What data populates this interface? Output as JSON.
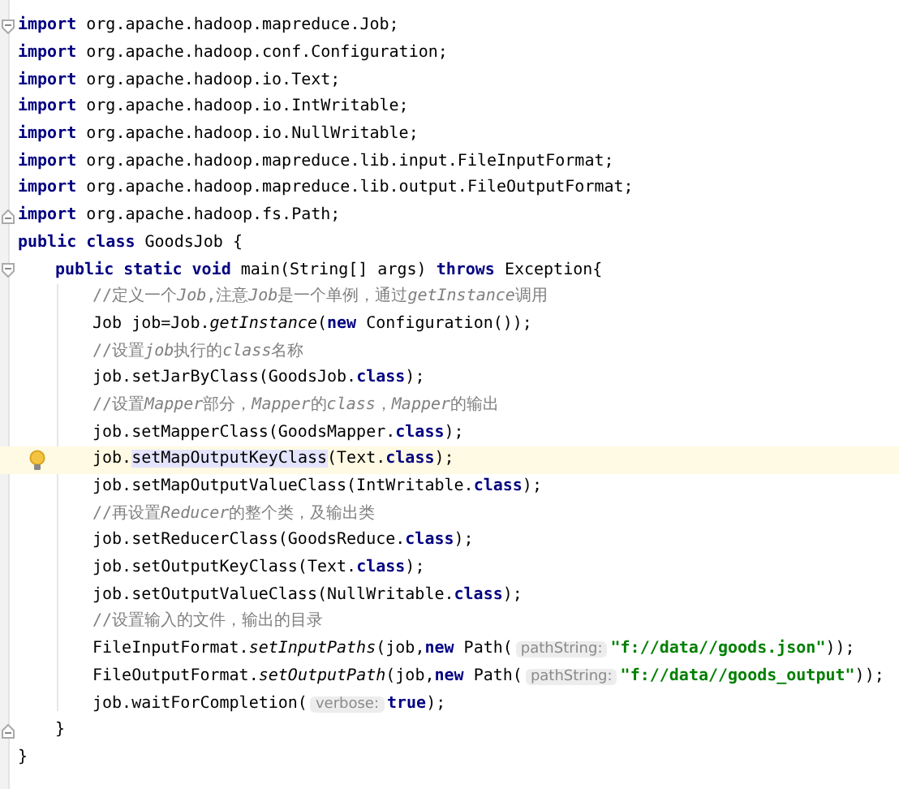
{
  "lines": [
    {
      "selected": false,
      "bulb": false,
      "fold_open": true,
      "fold_close": false,
      "tokens": [
        {
          "kind": "keyword",
          "text": "import"
        },
        {
          "kind": "plain",
          "text": " org.apache.hadoop.mapreduce.Job;"
        }
      ]
    },
    {
      "selected": false,
      "bulb": false,
      "fold_open": false,
      "fold_close": false,
      "tokens": [
        {
          "kind": "keyword",
          "text": "import"
        },
        {
          "kind": "plain",
          "text": " org.apache.hadoop.conf.Configuration;"
        }
      ]
    },
    {
      "selected": false,
      "bulb": false,
      "fold_open": false,
      "fold_close": false,
      "tokens": [
        {
          "kind": "keyword",
          "text": "import"
        },
        {
          "kind": "plain",
          "text": " org.apache.hadoop.io.Text;"
        }
      ]
    },
    {
      "selected": false,
      "bulb": false,
      "fold_open": false,
      "fold_close": false,
      "tokens": [
        {
          "kind": "keyword",
          "text": "import"
        },
        {
          "kind": "plain",
          "text": " org.apache.hadoop.io.IntWritable;"
        }
      ]
    },
    {
      "selected": false,
      "bulb": false,
      "fold_open": false,
      "fold_close": false,
      "tokens": [
        {
          "kind": "keyword",
          "text": "import"
        },
        {
          "kind": "plain",
          "text": " org.apache.hadoop.io.NullWritable;"
        }
      ]
    },
    {
      "selected": false,
      "bulb": false,
      "fold_open": false,
      "fold_close": false,
      "tokens": [
        {
          "kind": "keyword",
          "text": "import"
        },
        {
          "kind": "plain",
          "text": " org.apache.hadoop.mapreduce.lib.input.FileInputFormat;"
        }
      ]
    },
    {
      "selected": false,
      "bulb": false,
      "fold_open": false,
      "fold_close": false,
      "tokens": [
        {
          "kind": "keyword",
          "text": "import"
        },
        {
          "kind": "plain",
          "text": " org.apache.hadoop.mapreduce.lib.output.FileOutputFormat;"
        }
      ]
    },
    {
      "selected": false,
      "bulb": false,
      "fold_open": false,
      "fold_close": true,
      "tokens": [
        {
          "kind": "keyword",
          "text": "import"
        },
        {
          "kind": "plain",
          "text": " org.apache.hadoop.fs.Path;"
        }
      ]
    },
    {
      "selected": false,
      "bulb": false,
      "fold_open": false,
      "fold_close": false,
      "tokens": [
        {
          "kind": "keyword",
          "text": "public class"
        },
        {
          "kind": "plain",
          "text": " GoodsJob {"
        }
      ],
      "children": [
        {
          "selected": false,
          "bulb": false,
          "fold_open": true,
          "fold_close": false,
          "tokens": [
            {
              "kind": "keyword",
              "text": "public static void"
            },
            {
              "kind": "plain",
              "text": " main(String[] args) "
            },
            {
              "kind": "keyword",
              "text": "throws"
            },
            {
              "kind": "plain",
              "text": " Exception{"
            }
          ],
          "children": [
            {
              "selected": false,
              "bulb": false,
              "fold_open": false,
              "fold_close": false,
              "tokens": [
                {
                  "kind": "comment",
                  "text": "//定义一个"
                },
                {
                  "kind": "comment_italic",
                  "text": "Job"
                },
                {
                  "kind": "comment",
                  "text": ",注意"
                },
                {
                  "kind": "comment_italic",
                  "text": "Job"
                },
                {
                  "kind": "comment",
                  "text": "是一个单例，通过"
                },
                {
                  "kind": "comment_italic",
                  "text": "getInstance"
                },
                {
                  "kind": "comment",
                  "text": "调用"
                }
              ]
            },
            {
              "selected": false,
              "bulb": false,
              "fold_open": false,
              "fold_close": false,
              "tokens": [
                {
                  "kind": "plain",
                  "text": "Job job=Job."
                },
                {
                  "kind": "italic",
                  "text": "getInstance"
                },
                {
                  "kind": "plain",
                  "text": "("
                },
                {
                  "kind": "keyword",
                  "text": "new"
                },
                {
                  "kind": "plain",
                  "text": " Configuration());"
                }
              ]
            },
            {
              "selected": false,
              "bulb": false,
              "fold_open": false,
              "fold_close": false,
              "tokens": [
                {
                  "kind": "comment",
                  "text": "//设置"
                },
                {
                  "kind": "comment_italic",
                  "text": "job"
                },
                {
                  "kind": "comment",
                  "text": "执行的"
                },
                {
                  "kind": "comment_italic",
                  "text": "class"
                },
                {
                  "kind": "comment",
                  "text": "名称"
                }
              ]
            },
            {
              "selected": false,
              "bulb": false,
              "fold_open": false,
              "fold_close": false,
              "tokens": [
                {
                  "kind": "plain",
                  "text": "job.setJarByClass(GoodsJob."
                },
                {
                  "kind": "keyword",
                  "text": "class"
                },
                {
                  "kind": "plain",
                  "text": ");"
                }
              ]
            },
            {
              "selected": false,
              "bulb": false,
              "fold_open": false,
              "fold_close": false,
              "tokens": [
                {
                  "kind": "comment",
                  "text": "//设置"
                },
                {
                  "kind": "comment_italic",
                  "text": "Mapper"
                },
                {
                  "kind": "comment",
                  "text": "部分，"
                },
                {
                  "kind": "comment_italic",
                  "text": "Mapper"
                },
                {
                  "kind": "comment",
                  "text": "的"
                },
                {
                  "kind": "comment_italic",
                  "text": "class"
                },
                {
                  "kind": "comment",
                  "text": "，"
                },
                {
                  "kind": "comment_italic",
                  "text": "Mapper"
                },
                {
                  "kind": "comment",
                  "text": "的输出"
                }
              ]
            },
            {
              "selected": false,
              "bulb": false,
              "fold_open": false,
              "fold_close": false,
              "tokens": [
                {
                  "kind": "plain",
                  "text": "job.setMapperClass(GoodsMapper."
                },
                {
                  "kind": "keyword",
                  "text": "class"
                },
                {
                  "kind": "plain",
                  "text": ");"
                }
              ]
            },
            {
              "selected": true,
              "bulb": true,
              "fold_open": false,
              "fold_close": false,
              "tokens": [
                {
                  "kind": "plain",
                  "text": "job."
                },
                {
                  "kind": "match",
                  "text": "setMapOutputKeyClass"
                },
                {
                  "kind": "plain",
                  "text": "(Text."
                },
                {
                  "kind": "keyword",
                  "text": "class"
                },
                {
                  "kind": "plain",
                  "text": ");"
                }
              ]
            },
            {
              "selected": false,
              "bulb": false,
              "fold_open": false,
              "fold_close": false,
              "tokens": [
                {
                  "kind": "plain",
                  "text": "job.setMapOutputValueClass(IntWritable."
                },
                {
                  "kind": "keyword",
                  "text": "class"
                },
                {
                  "kind": "plain",
                  "text": ");"
                }
              ]
            },
            {
              "selected": false,
              "bulb": false,
              "fold_open": false,
              "fold_close": false,
              "tokens": [
                {
                  "kind": "comment",
                  "text": "//再设置"
                },
                {
                  "kind": "comment_italic",
                  "text": "Reducer"
                },
                {
                  "kind": "comment",
                  "text": "的整个类，及输出类"
                }
              ]
            },
            {
              "selected": false,
              "bulb": false,
              "fold_open": false,
              "fold_close": false,
              "tokens": [
                {
                  "kind": "plain",
                  "text": "job.setReducerClass(GoodsReduce."
                },
                {
                  "kind": "keyword",
                  "text": "class"
                },
                {
                  "kind": "plain",
                  "text": ");"
                }
              ]
            },
            {
              "selected": false,
              "bulb": false,
              "fold_open": false,
              "fold_close": false,
              "tokens": [
                {
                  "kind": "plain",
                  "text": "job.setOutputKeyClass(Text."
                },
                {
                  "kind": "keyword",
                  "text": "class"
                },
                {
                  "kind": "plain",
                  "text": ");"
                }
              ]
            },
            {
              "selected": false,
              "bulb": false,
              "fold_open": false,
              "fold_close": false,
              "tokens": [
                {
                  "kind": "plain",
                  "text": "job.setOutputValueClass(NullWritable."
                },
                {
                  "kind": "keyword",
                  "text": "class"
                },
                {
                  "kind": "plain",
                  "text": ");"
                }
              ]
            },
            {
              "selected": false,
              "bulb": false,
              "fold_open": false,
              "fold_close": false,
              "tokens": [
                {
                  "kind": "comment",
                  "text": "//设置输入的文件，输出的目录"
                }
              ]
            },
            {
              "selected": false,
              "bulb": false,
              "fold_open": false,
              "fold_close": false,
              "tokens": [
                {
                  "kind": "plain",
                  "text": "FileInputFormat."
                },
                {
                  "kind": "italic",
                  "text": "setInputPaths"
                },
                {
                  "kind": "plain",
                  "text": "(job,"
                },
                {
                  "kind": "keyword",
                  "text": "new"
                },
                {
                  "kind": "plain",
                  "text": " Path("
                },
                {
                  "kind": "hint",
                  "text": "pathString:"
                },
                {
                  "kind": "string",
                  "text": "\"f://data//goods.json\""
                },
                {
                  "kind": "plain",
                  "text": "));"
                }
              ]
            },
            {
              "selected": false,
              "bulb": false,
              "fold_open": false,
              "fold_close": false,
              "tokens": [
                {
                  "kind": "plain",
                  "text": "FileOutputFormat."
                },
                {
                  "kind": "italic",
                  "text": "setOutputPath"
                },
                {
                  "kind": "plain",
                  "text": "(job,"
                },
                {
                  "kind": "keyword",
                  "text": "new"
                },
                {
                  "kind": "plain",
                  "text": " Path("
                },
                {
                  "kind": "hint",
                  "text": "pathString:"
                },
                {
                  "kind": "string",
                  "text": "\"f://data//goods_output\""
                },
                {
                  "kind": "plain",
                  "text": "));"
                }
              ]
            },
            {
              "selected": false,
              "bulb": false,
              "fold_open": false,
              "fold_close": false,
              "tokens": [
                {
                  "kind": "plain",
                  "text": "job.waitForCompletion("
                },
                {
                  "kind": "hint",
                  "text": "verbose:"
                },
                {
                  "kind": "keyword",
                  "text": "true"
                },
                {
                  "kind": "plain",
                  "text": ");"
                }
              ]
            }
          ]
        },
        {
          "selected": false,
          "bulb": false,
          "fold_open": false,
          "fold_close": true,
          "tokens": [
            {
              "kind": "plain",
              "text": "}"
            }
          ]
        }
      ]
    },
    {
      "selected": false,
      "bulb": false,
      "fold_open": false,
      "fold_close": false,
      "tokens": [
        {
          "kind": "plain",
          "text": "}"
        }
      ]
    }
  ]
}
